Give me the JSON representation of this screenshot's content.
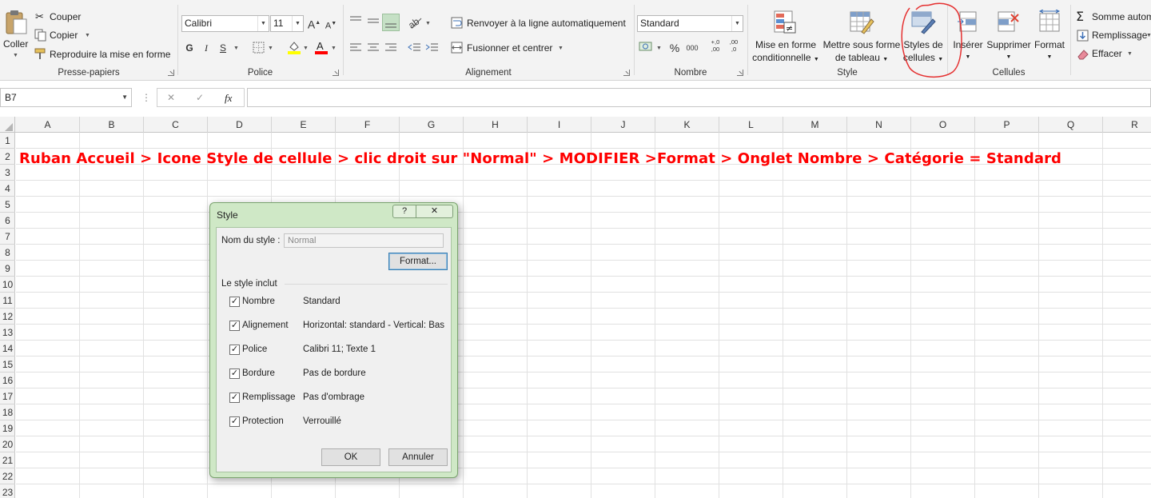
{
  "ribbon": {
    "clipboard": {
      "label": "Presse-papiers",
      "paste": "Coller",
      "cut": "Couper",
      "copy": "Copier",
      "format_painter": "Reproduire la mise en forme"
    },
    "font": {
      "label": "Police",
      "font_name": "Calibri",
      "font_size": "11",
      "bold": "G",
      "italic": "I",
      "underline": "S",
      "grow": "A",
      "shrink": "A"
    },
    "alignment": {
      "label": "Alignement",
      "wrap_text": "Renvoyer à la ligne automatiquement",
      "merge_center": "Fusionner et centrer"
    },
    "number": {
      "label": "Nombre",
      "format": "Standard",
      "percent": "%",
      "thousands": "000",
      "inc_decimal": "+,0\n,00",
      "dec_decimal": ",00\n,0"
    },
    "style": {
      "label": "Style",
      "conditional_line1": "Mise en forme",
      "conditional_line2": "conditionnelle",
      "table_line1": "Mettre sous forme",
      "table_line2": "de tableau",
      "cell_styles_line1": "Styles de",
      "cell_styles_line2": "cellules"
    },
    "cells": {
      "label": "Cellules",
      "insert": "Insérer",
      "delete": "Supprimer",
      "format": "Format"
    },
    "editing": {
      "autosum": "Somme autom",
      "fill": "Remplissage",
      "clear": "Effacer"
    }
  },
  "formula_bar": {
    "name_box": "B7",
    "fx": "fx",
    "cancel": "✕",
    "enter": "✓"
  },
  "grid": {
    "columns": [
      "A",
      "B",
      "C",
      "D",
      "E",
      "F",
      "G",
      "H",
      "I",
      "J",
      "K",
      "L",
      "M",
      "N",
      "O",
      "P",
      "Q",
      "R"
    ],
    "rows": [
      "1",
      "2",
      "3",
      "4",
      "5",
      "6",
      "7",
      "8",
      "9",
      "10",
      "11",
      "12",
      "13",
      "14",
      "15",
      "16",
      "17",
      "18",
      "19",
      "20",
      "21",
      "22",
      "23"
    ],
    "annotation": "Ruban Accueil > Icone Style de cellule > clic droit sur \"Normal\" > MODIFIER >Format > Onglet Nombre > Catégorie = Standard"
  },
  "dialog": {
    "title": "Style",
    "help": "?",
    "close": "✕",
    "style_name_label": "Nom du style :",
    "style_name_value": "Normal",
    "format_button": "Format...",
    "includes_label": "Le style inclut",
    "items": [
      {
        "label": "Nombre",
        "value": "Standard",
        "checked": true
      },
      {
        "label": "Alignement",
        "value": "Horizontal: standard - Vertical: Bas",
        "checked": true
      },
      {
        "label": "Police",
        "value": "Calibri 11; Texte 1",
        "checked": true
      },
      {
        "label": "Bordure",
        "value": "Pas de bordure",
        "checked": true
      },
      {
        "label": "Remplissage",
        "value": "Pas d'ombrage",
        "checked": true
      },
      {
        "label": "Protection",
        "value": "Verrouillé",
        "checked": true
      }
    ],
    "ok": "OK",
    "cancel": "Annuler"
  },
  "colors": {
    "annotation": "#ff0000",
    "dialog_frame": "#cfe8c6",
    "ribbon_bg": "#f3f3f3",
    "font_color_bar": "#ff0000",
    "highlight_bar": "#ffff00"
  }
}
